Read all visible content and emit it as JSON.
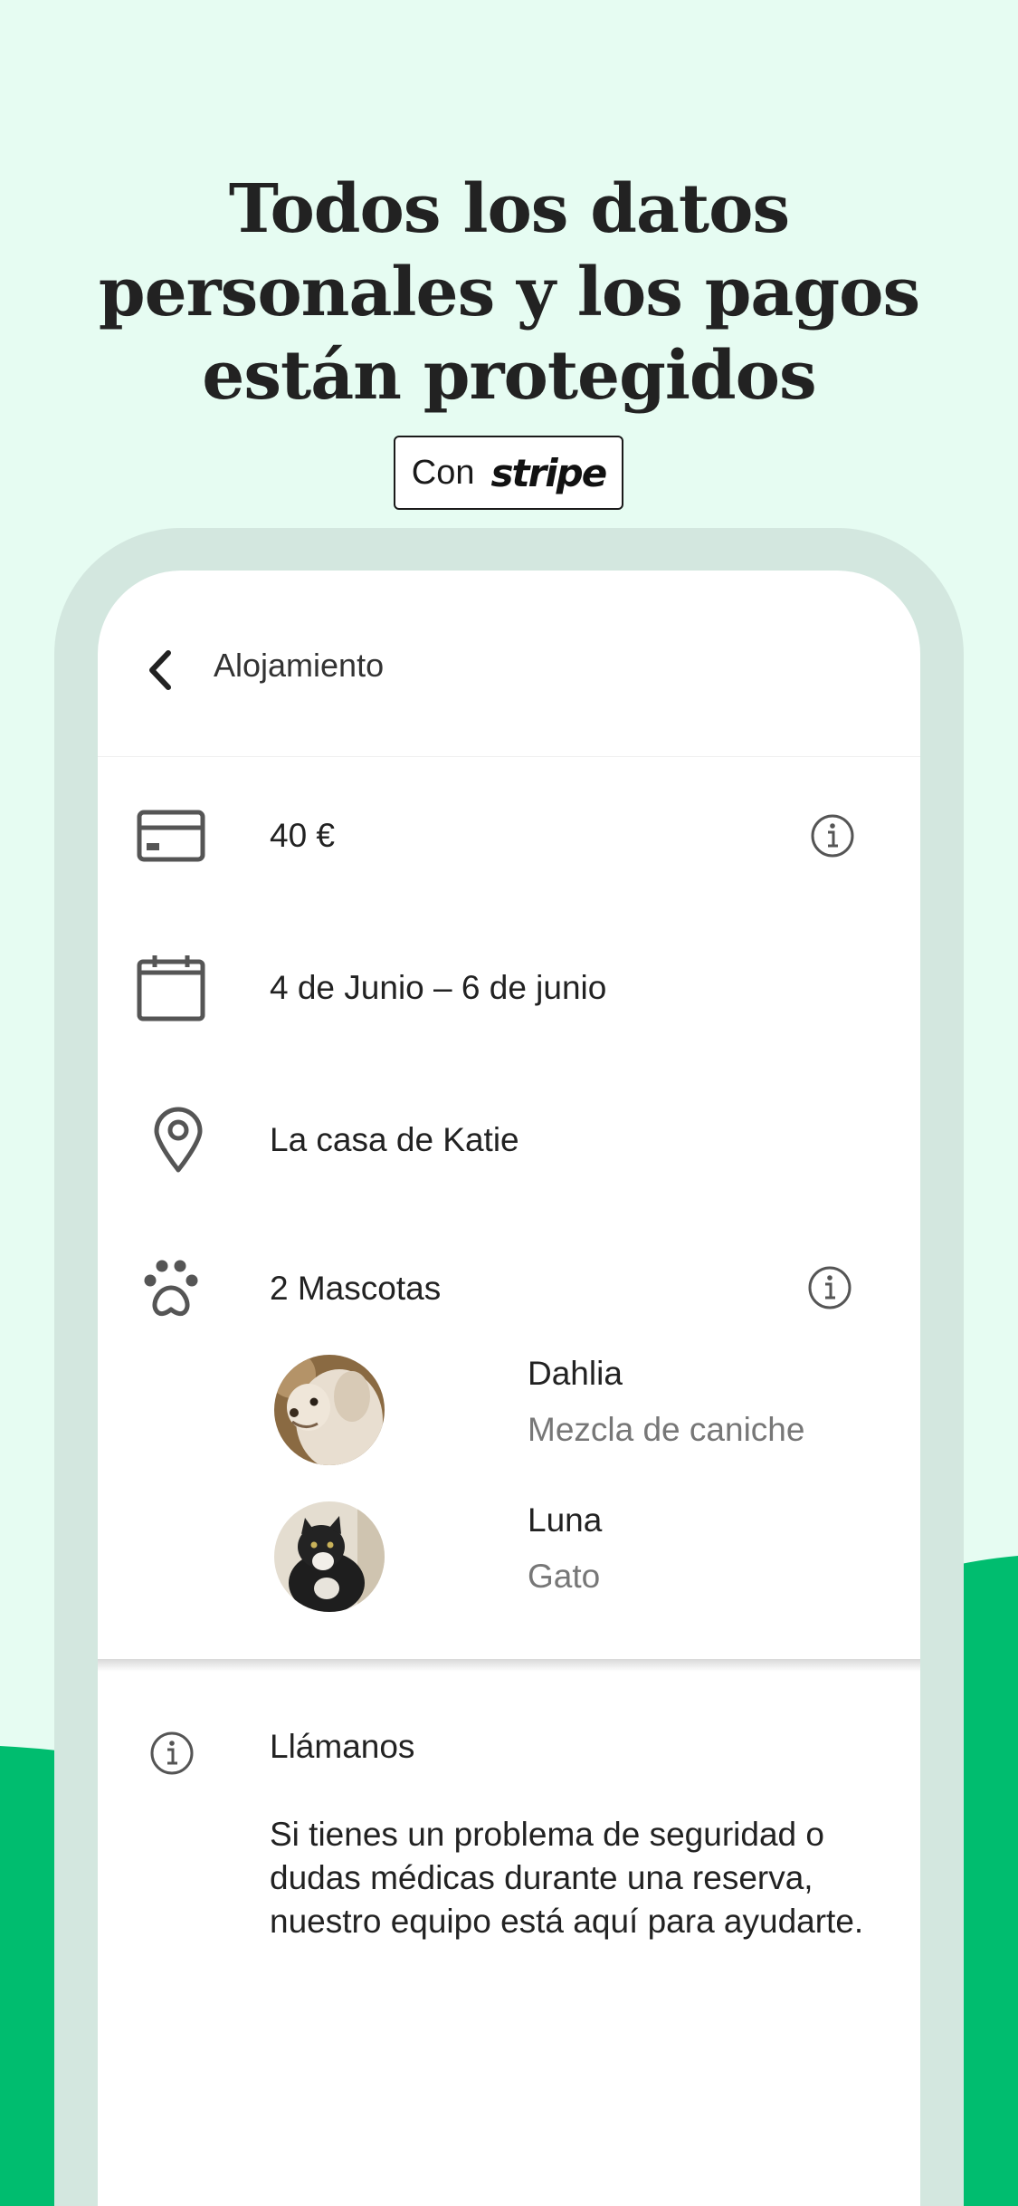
{
  "headline": {
    "line1": "Todos los datos",
    "line2": "personales y los pagos",
    "line3": "están protegidos"
  },
  "badge": {
    "prefix": "Con",
    "brand": "stripe"
  },
  "nav": {
    "title": "Alojamiento",
    "back_icon": "chevron-left-icon"
  },
  "booking": {
    "price": "40 €",
    "dates": "4 de Junio – 6 de junio",
    "location": "La casa de Katie",
    "pets_label": "2 Mascotas"
  },
  "pets": [
    {
      "name": "Dahlia",
      "breed": "Mezcla de caniche"
    },
    {
      "name": "Luna",
      "breed": "Gato"
    }
  ],
  "help": {
    "title": "Llámanos",
    "body": "Si tienes un problema de seguridad o dudas médicas durante una reserva, nuestro equipo está aquí para ayudarte."
  },
  "colors": {
    "background": "#e6fcf2",
    "accent_green": "#00bd6f",
    "frame": "#d3e7df",
    "icon_gray": "#555555"
  }
}
